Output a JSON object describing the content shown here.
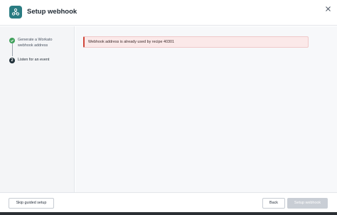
{
  "header": {
    "title": "Setup webhook",
    "logo_icon": "workato-logo-icon",
    "close_icon": "close-icon"
  },
  "sidebar": {
    "steps": [
      {
        "label": "Generate a Workato webhook address",
        "status": "done",
        "icon": "check-icon"
      },
      {
        "label": "Listen for an event",
        "status": "current",
        "number": "2"
      }
    ]
  },
  "main": {
    "alert": {
      "text": "Webhook address is already used by recipe 40301",
      "type": "error",
      "accent_color": "#d0463a"
    }
  },
  "footer": {
    "skip_label": "Skip guided setup",
    "back_label": "Back",
    "setup_label": "Setup webhook",
    "setup_disabled": true
  },
  "colors": {
    "brand": "#2a7c82",
    "success": "#3fa05a",
    "current_step": "#1f2f38"
  }
}
